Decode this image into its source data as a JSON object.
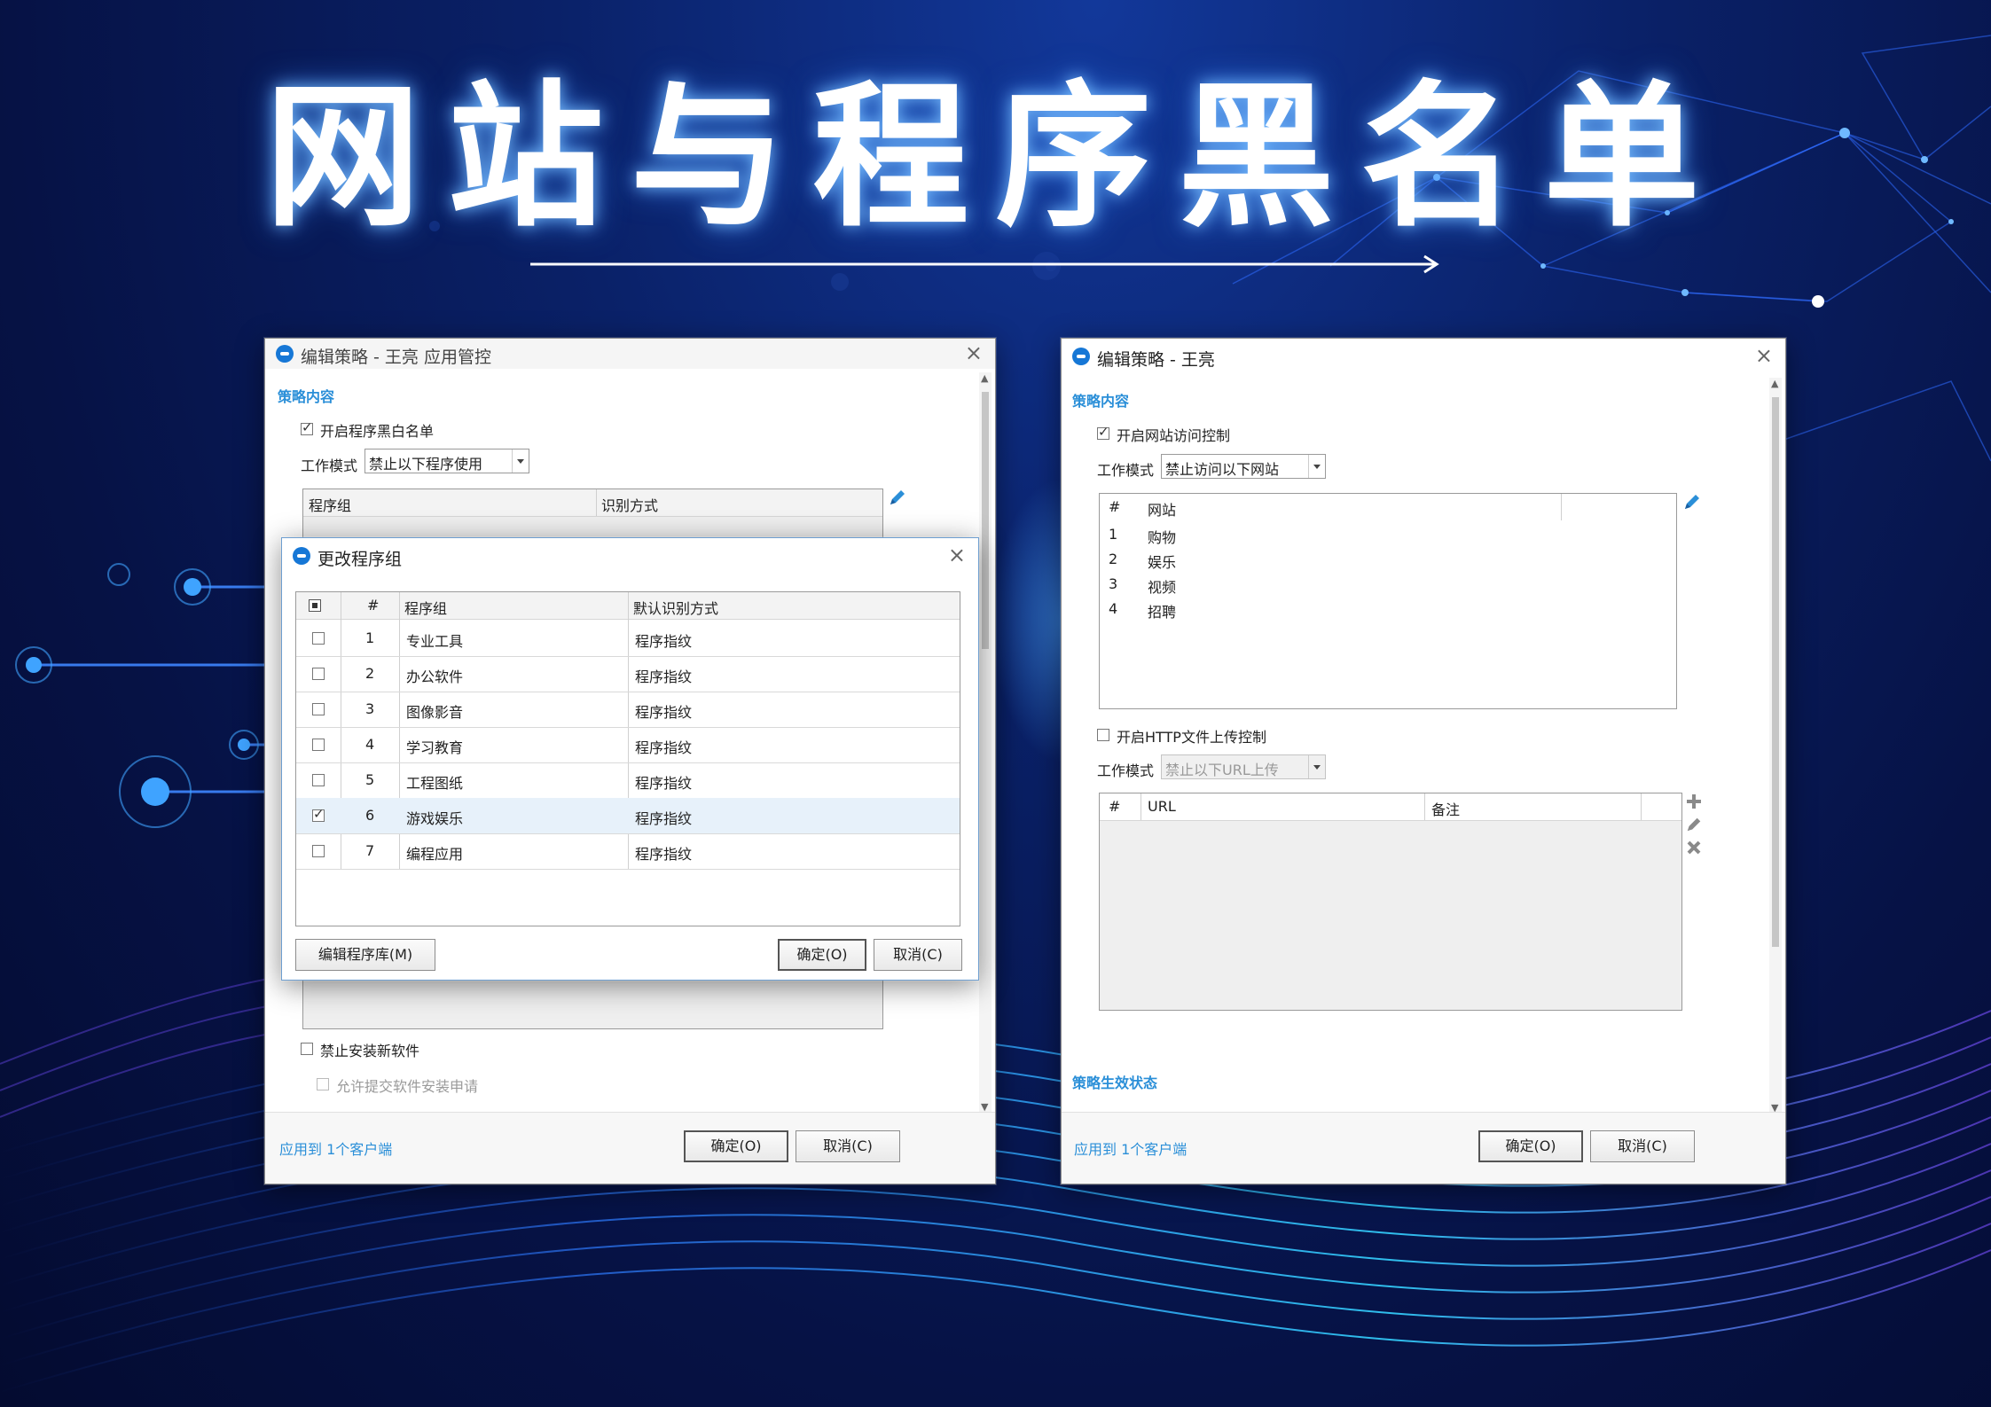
{
  "headline": "网站与程序黑名单",
  "colors": {
    "accent": "#2b8fd8",
    "app_icon": "#1677d6",
    "bg_dark": "#061245"
  },
  "left_window": {
    "title": "编辑策略 - 王亮 应用管控",
    "section_title": "策略内容",
    "enable_blacklist": {
      "label": "开启程序黑白名单",
      "checked": true
    },
    "work_mode": {
      "label": "工作模式",
      "value": "禁止以下程序使用"
    },
    "table_headers": [
      "程序组",
      "识别方式"
    ],
    "disable_install": {
      "label": "禁止安装新软件",
      "checked": false
    },
    "allow_request": {
      "label": "允许提交软件安装申请",
      "checked": false
    },
    "apply_link": "应用到 1个客户端",
    "ok_label": "确定(O)",
    "cancel_label": "取消(C)",
    "icons": [
      "app-logo-icon",
      "close-icon",
      "pencil-icon"
    ]
  },
  "program_group_dialog": {
    "title": "更改程序组",
    "headers": [
      "#",
      "程序组",
      "默认识别方式"
    ],
    "rows": [
      {
        "num": "1",
        "group": "专业工具",
        "method": "程序指纹",
        "checked": false
      },
      {
        "num": "2",
        "group": "办公软件",
        "method": "程序指纹",
        "checked": false
      },
      {
        "num": "3",
        "group": "图像影音",
        "method": "程序指纹",
        "checked": false
      },
      {
        "num": "4",
        "group": "学习教育",
        "method": "程序指纹",
        "checked": false
      },
      {
        "num": "5",
        "group": "工程图纸",
        "method": "程序指纹",
        "checked": false
      },
      {
        "num": "6",
        "group": "游戏娱乐",
        "method": "程序指纹",
        "checked": true
      },
      {
        "num": "7",
        "group": "编程应用",
        "method": "程序指纹",
        "checked": false
      }
    ],
    "edit_library_label": "编辑程序库(M)",
    "ok_label": "确定(O)",
    "cancel_label": "取消(C)"
  },
  "right_window": {
    "title": "编辑策略 - 王亮",
    "section_title": "策略内容",
    "enable_web_control": {
      "label": "开启网站访问控制",
      "checked": true
    },
    "work_mode": {
      "label": "工作模式",
      "value": "禁止访问以下网站"
    },
    "site_headers": [
      "#",
      "网站"
    ],
    "sites": [
      {
        "num": "1",
        "name": "购物"
      },
      {
        "num": "2",
        "name": "娱乐"
      },
      {
        "num": "3",
        "name": "视频"
      },
      {
        "num": "4",
        "name": "招聘"
      }
    ],
    "enable_http_upload": {
      "label": "开启HTTP文件上传控制",
      "checked": false
    },
    "upload_mode": {
      "label": "工作模式",
      "value": "禁止以下URL上传"
    },
    "url_headers": [
      "#",
      "URL",
      "备注"
    ],
    "status_section": "策略生效状态",
    "apply_link": "应用到 1个客户端",
    "ok_label": "确定(O)",
    "cancel_label": "取消(C)",
    "icons": [
      "app-logo-icon",
      "close-icon",
      "pencil-icon",
      "plus-icon",
      "x-icon"
    ]
  }
}
